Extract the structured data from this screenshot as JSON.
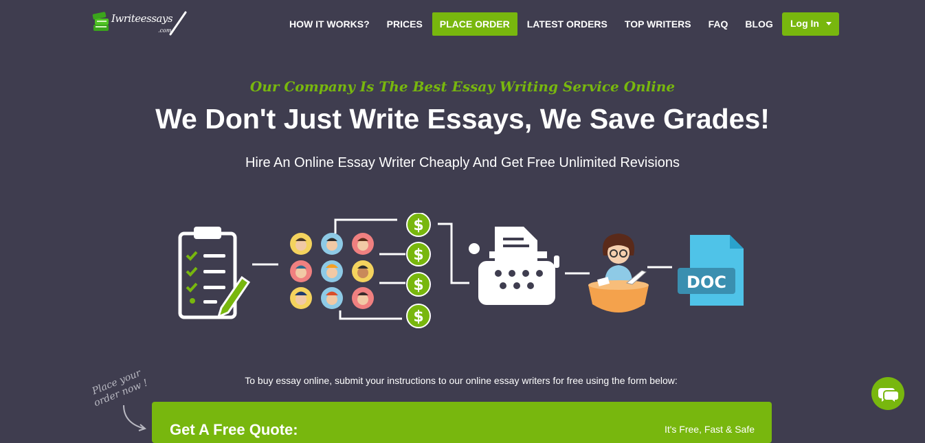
{
  "nav": {
    "logo_text": "Iwriteessays",
    "logo_suffix": ".com",
    "items": [
      {
        "label": "HOW IT WORKS?"
      },
      {
        "label": "PRICES"
      },
      {
        "label": "PLACE ORDER"
      },
      {
        "label": "LATEST ORDERS"
      },
      {
        "label": "TOP WRITERS"
      },
      {
        "label": "FAQ"
      },
      {
        "label": "BLOG"
      }
    ],
    "login_label": "Log In"
  },
  "hero": {
    "tagline": "Our Company Is The Best Essay Writing Service Online",
    "title": "We Don't Just Write Essays, We Save Grades!",
    "subtitle": "Hire An Online Essay Writer Cheaply And Get Free Unlimited Revisions"
  },
  "illustration": {
    "doc_label": "DOC",
    "currency_symbol": "$"
  },
  "instructions": "To buy essay online, submit your instructions to our online essay writers for free using the form below:",
  "handwriting": {
    "line1": "Place your",
    "line2": "order now !"
  },
  "quote": {
    "title": "Get A Free Quote:",
    "note": "It's Free, Fast & Safe"
  },
  "colors": {
    "background": "#3f3d4f",
    "accent": "#78b70e"
  }
}
